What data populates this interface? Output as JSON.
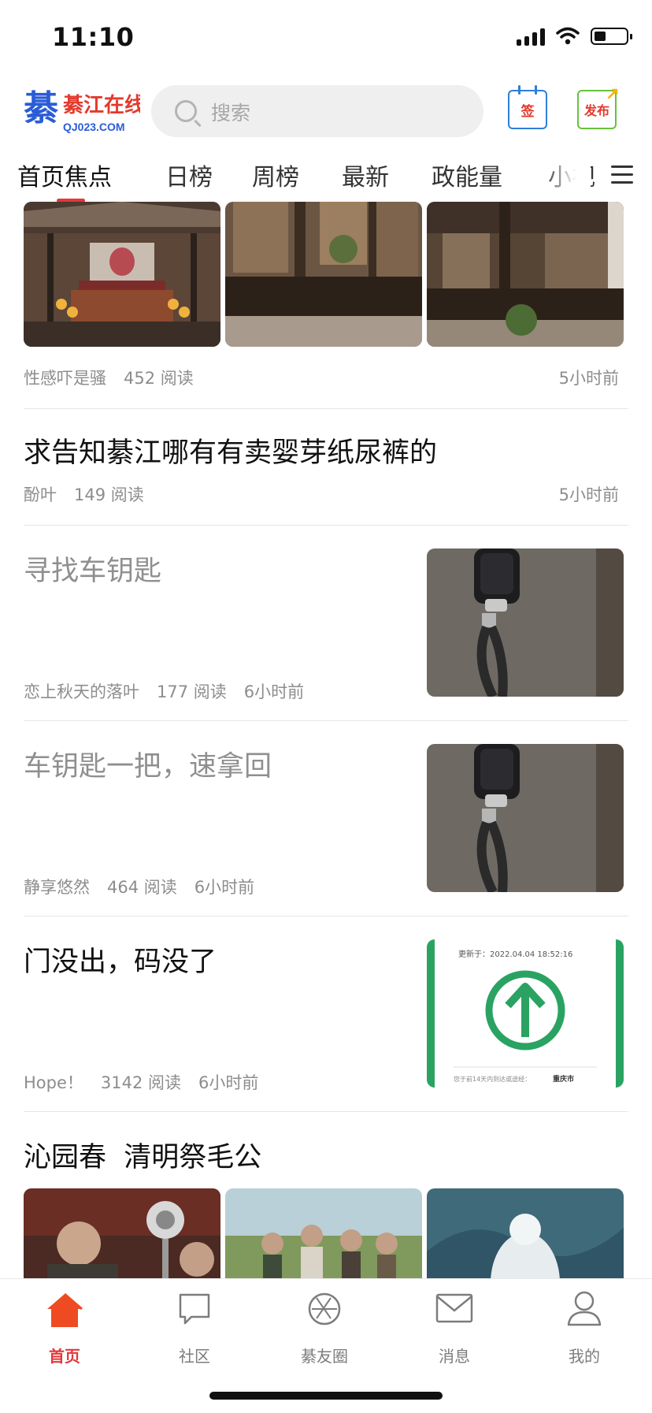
{
  "status_bar": {
    "time": "11:10",
    "battery_level": 0.25
  },
  "header": {
    "logo_text": "綦江在线",
    "logo_sub": "QJ023.COM",
    "search_placeholder": "搜索",
    "checkin_label": "签",
    "publish_label": "发布"
  },
  "tabs": [
    "首页焦点",
    "日榜",
    "周榜",
    "最新",
    "政能量",
    "小视"
  ],
  "active_tab": 0,
  "feed": {
    "post1": {
      "author": "性感吓是骚",
      "reads": "452 阅读",
      "time": "5小时前"
    },
    "post2": {
      "title": "求告知綦江哪有有卖婴芽纸尿裤的",
      "author": "酚叶",
      "reads": "149 阅读",
      "time": "5小时前"
    },
    "post3": {
      "title": "寻找车钥匙",
      "author": "恋上秋天的落叶",
      "reads": "177 阅读",
      "time": "6小时前"
    },
    "post4": {
      "title": "车钥匙一把，速拿回",
      "author": "静享悠然",
      "reads": "464 阅读",
      "time": "6小时前"
    },
    "post5": {
      "title": "门没出，码没了",
      "author": "Hope！",
      "reads": "3142 阅读",
      "time": "6小时前",
      "thumb_updated": "更新于：2022.04.04 18:52:16",
      "thumb_footer": "您于前14天内到达或途经：",
      "thumb_city": "重庆市"
    },
    "post6": {
      "title": "沁园春  清明祭毛公"
    }
  },
  "tabbar": [
    {
      "label": "首页",
      "icon": "home-icon",
      "active": true
    },
    {
      "label": "社区",
      "icon": "community-icon",
      "active": false
    },
    {
      "label": "綦友圈",
      "icon": "moments-icon",
      "active": false
    },
    {
      "label": "消息",
      "icon": "message-icon",
      "active": false
    },
    {
      "label": "我的",
      "icon": "profile-icon",
      "active": false
    }
  ],
  "colors": {
    "accent": "#e2383a",
    "home_icon": "#ef4b22",
    "green": "#2aa362"
  }
}
